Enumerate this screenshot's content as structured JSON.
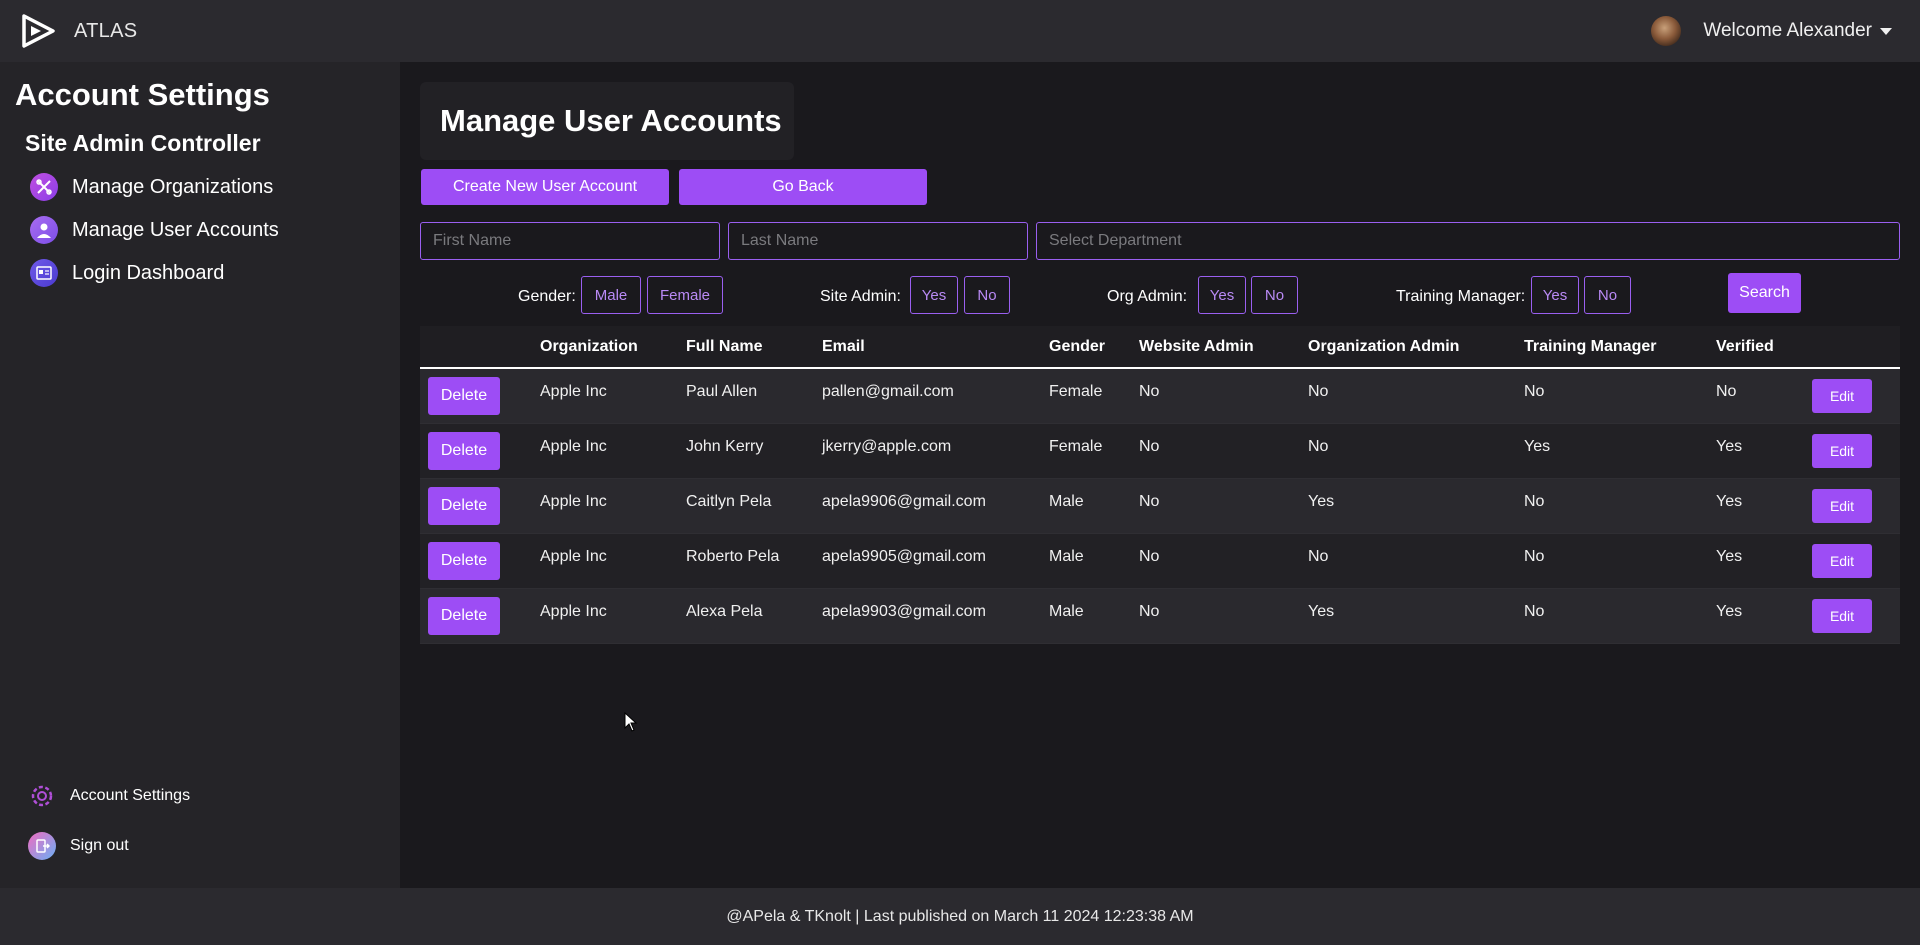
{
  "header": {
    "brand": "ATLAS",
    "logo_icon": "play-triangle-logo",
    "welcome": "Welcome Alexander"
  },
  "sidebar": {
    "title": "Account Settings",
    "section": "Site Admin Controller",
    "items": [
      {
        "label": "Manage Organizations",
        "icon": "organizations-icon"
      },
      {
        "label": "Manage User Accounts",
        "icon": "user-icon"
      },
      {
        "label": "Login Dashboard",
        "icon": "dashboard-icon"
      }
    ],
    "bottom": [
      {
        "label": "Account Settings",
        "icon": "gear-icon"
      },
      {
        "label": "Sign out",
        "icon": "sign-out-icon"
      }
    ]
  },
  "main": {
    "title": "Manage User Accounts",
    "create_button": "Create New User Account",
    "back_button": "Go Back",
    "inputs": {
      "first_name_placeholder": "First Name",
      "last_name_placeholder": "Last Name",
      "department_placeholder": "Select Department"
    },
    "filters": {
      "gender_label": "Gender:",
      "gender_options": [
        "Male",
        "Female"
      ],
      "site_admin_label": "Site Admin:",
      "org_admin_label": "Org Admin:",
      "training_manager_label": "Training Manager:",
      "yes": "Yes",
      "no": "No",
      "search_button": "Search"
    },
    "table": {
      "headers": [
        "",
        "Organization",
        "Full Name",
        "Email",
        "Gender",
        "Website Admin",
        "Organization Admin",
        "Training Manager",
        "Verified",
        ""
      ],
      "delete_label": "Delete",
      "edit_label": "Edit",
      "rows": [
        [
          "Apple Inc",
          "Paul Allen",
          "pallen@gmail.com",
          "Female",
          "No",
          "No",
          "No",
          "No"
        ],
        [
          "Apple Inc",
          "John Kerry",
          "jkerry@apple.com",
          "Female",
          "No",
          "No",
          "Yes",
          "Yes"
        ],
        [
          "Apple Inc",
          "Caitlyn Pela",
          "apela9906@gmail.com",
          "Male",
          "No",
          "Yes",
          "No",
          "Yes"
        ],
        [
          "Apple Inc",
          "Roberto Pela",
          "apela9905@gmail.com",
          "Male",
          "No",
          "No",
          "No",
          "Yes"
        ],
        [
          "Apple Inc",
          "Alexa Pela",
          "apela9903@gmail.com",
          "Male",
          "No",
          "Yes",
          "No",
          "Yes"
        ]
      ]
    }
  },
  "footer": {
    "text": "@APela & TKnolt | Last published on March 11 2024 12:23:38 AM"
  },
  "colors": {
    "accent": "#9d4df5",
    "background": "#1a191d",
    "sidebar": "#252428",
    "topbar": "#2b2a2f"
  }
}
